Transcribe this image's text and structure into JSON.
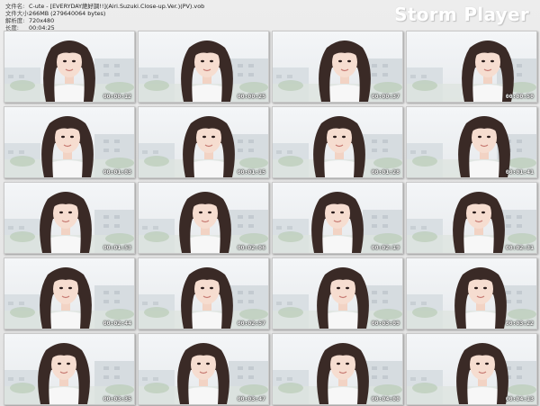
{
  "header": {
    "rows": [
      {
        "label": "文件名:",
        "value": "C-ute - [EVERYDAY絶好調!!](Airi.Suzuki.Close-up.Ver.)(PV).vob"
      },
      {
        "label": "文件大小:",
        "value": "266MB (279640064 bytes)"
      },
      {
        "label": "解析度:",
        "value": "720x480"
      },
      {
        "label": "长度:",
        "value": "00:04:25"
      }
    ],
    "brand": "Storm Player"
  },
  "thumbnails": [
    {
      "time": "00:00:12"
    },
    {
      "time": "00:00:25"
    },
    {
      "time": "00:00:37"
    },
    {
      "time": "00:00:50"
    },
    {
      "time": "00:01:03"
    },
    {
      "time": "00:01:15"
    },
    {
      "time": "00:01:28"
    },
    {
      "time": "00:01:41"
    },
    {
      "time": "00:01:53"
    },
    {
      "time": "00:02:06"
    },
    {
      "time": "00:02:19"
    },
    {
      "time": "00:02:31"
    },
    {
      "time": "00:02:44"
    },
    {
      "time": "00:02:57"
    },
    {
      "time": "00:03:09"
    },
    {
      "time": "00:03:22"
    },
    {
      "time": "00:03:35"
    },
    {
      "time": "00:03:47"
    },
    {
      "time": "00:04:00"
    },
    {
      "time": "00:04:13"
    }
  ]
}
